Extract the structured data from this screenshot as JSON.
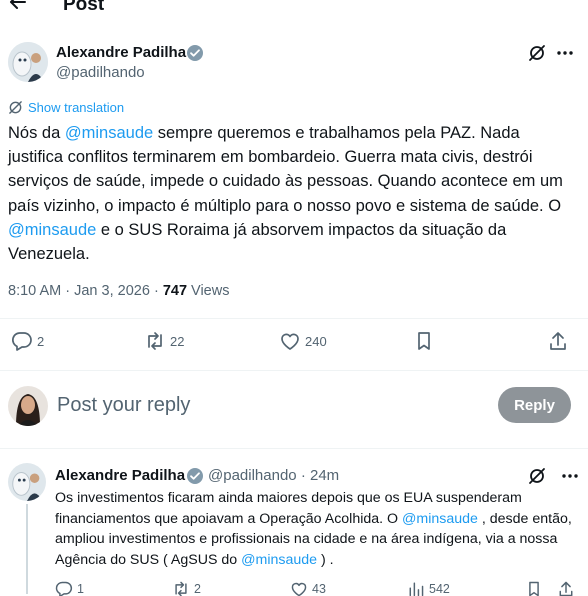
{
  "header": {
    "title": "Post"
  },
  "post": {
    "author_name": "Alexandre Padilha",
    "handle": "@padilhando",
    "show_translation": "Show translation",
    "text": [
      {
        "t": "Nós da ",
        "m": false
      },
      {
        "t": "@minsaude",
        "m": true
      },
      {
        "t": " sempre queremos e trabalhamos pela PAZ. Nada justifica conflitos terminarem em bombardeio. Guerra mata civis, destrói serviços de saúde, impede o cuidado às pessoas. Quando acontece em um país vizinho, o impacto é múltiplo para o nosso povo e sistema de saúde. O ",
        "m": false
      },
      {
        "t": "@minsaude",
        "m": true
      },
      {
        "t": " e o SUS Roraima já absorvem impactos da situação da Venezuela.",
        "m": false
      }
    ],
    "time": "8:10 AM",
    "date": "Jan 3, 2026",
    "views_count": "747",
    "views_label": "Views",
    "separator": "·",
    "replies": "2",
    "reposts": "22",
    "likes": "240"
  },
  "reply_composer": {
    "placeholder": "Post your reply",
    "button_label": "Reply"
  },
  "reply": {
    "author_name": "Alexandre Padilha",
    "handle": "@padilhando",
    "separator": "·",
    "time_ago": "24m",
    "text": [
      {
        "t": "Os investimentos ficaram ainda maiores depois que os EUA suspenderam financiamentos que apoiavam a Operação Acolhida. O ",
        "m": false
      },
      {
        "t": "@minsaude",
        "m": true
      },
      {
        "t": " , desde então, ampliou investimentos e profissionais na cidade e na área indígena, via a nossa Agência do SUS ( AgSUS do ",
        "m": false
      },
      {
        "t": "@minsaude",
        "m": true
      },
      {
        "t": " ) .",
        "m": false
      }
    ],
    "replies": "1",
    "reposts": "2",
    "likes": "43",
    "views": "542"
  },
  "colors": {
    "accent": "#1d9bf0",
    "muted": "#536471",
    "reply_button_bg": "#8e9499"
  },
  "icons": [
    "back-arrow-icon",
    "verified-icon",
    "grok-icon",
    "more-icon",
    "translate-icon",
    "reply-icon",
    "repost-icon",
    "like-icon",
    "bookmark-icon",
    "share-icon",
    "views-icon"
  ]
}
